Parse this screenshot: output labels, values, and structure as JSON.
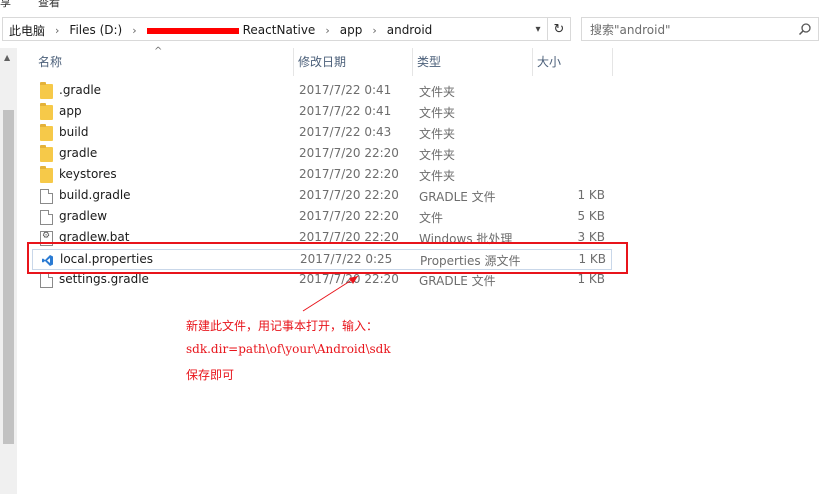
{
  "menu": {
    "item_1": "享",
    "item_2": "查看"
  },
  "address_bar": {
    "crumbs": [
      "此电脑",
      "Files (D:)",
      "ReactNative",
      "app",
      "android"
    ]
  },
  "search": {
    "placeholder": "搜索\"android\""
  },
  "columns": {
    "name": "名称",
    "date": "修改日期",
    "type": "类型",
    "size": "大小"
  },
  "files": [
    {
      "name": ".gradle",
      "date": "2017/7/22 0:41",
      "type": "文件夹",
      "size": "",
      "icon": "folder-icon"
    },
    {
      "name": "app",
      "date": "2017/7/22 0:41",
      "type": "文件夹",
      "size": "",
      "icon": "folder-icon"
    },
    {
      "name": "build",
      "date": "2017/7/22 0:43",
      "type": "文件夹",
      "size": "",
      "icon": "folder-icon"
    },
    {
      "name": "gradle",
      "date": "2017/7/20 22:20",
      "type": "文件夹",
      "size": "",
      "icon": "folder-icon"
    },
    {
      "name": "keystores",
      "date": "2017/7/20 22:20",
      "type": "文件夹",
      "size": "",
      "icon": "folder-icon"
    },
    {
      "name": "build.gradle",
      "date": "2017/7/20 22:20",
      "type": "GRADLE 文件",
      "size": "1 KB",
      "icon": "file-icon"
    },
    {
      "name": "gradlew",
      "date": "2017/7/20 22:20",
      "type": "文件",
      "size": "5 KB",
      "icon": "file-icon"
    },
    {
      "name": "gradlew.bat",
      "date": "2017/7/20 22:20",
      "type": "Windows 批处理",
      "size": "3 KB",
      "icon": "batch-file-icon"
    },
    {
      "name": "local.properties",
      "date": "2017/7/22 0:25",
      "type": "Properties 源文件",
      "size": "1 KB",
      "icon": "vscode-file-icon"
    },
    {
      "name": "settings.gradle",
      "date": "2017/7/20 22:20",
      "type": "GRADLE 文件",
      "size": "1 KB",
      "icon": "file-icon"
    }
  ],
  "annotation": {
    "line_1": "新建此文件，用记事本打开，输入：",
    "line_2": "sdk.dir=path\\of\\your\\Android\\sdk",
    "line_3": "保存即可"
  },
  "colors": {
    "highlight": "#e8141b",
    "folder": "#f6c949",
    "header_text": "#4c607a"
  }
}
